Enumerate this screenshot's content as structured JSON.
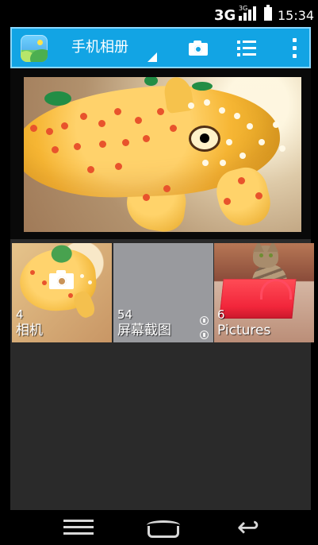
{
  "status_bar": {
    "network": "3G",
    "signal_mini": "3G",
    "time": "15:34"
  },
  "header": {
    "title": "手机相册",
    "actions": [
      "camera",
      "list",
      "more"
    ]
  },
  "albums": [
    {
      "count": "4",
      "name": "相机"
    },
    {
      "count": "54",
      "name": "屏幕截图"
    },
    {
      "count": "6",
      "name": "Pictures"
    }
  ],
  "navigation": {
    "back": "↩"
  }
}
